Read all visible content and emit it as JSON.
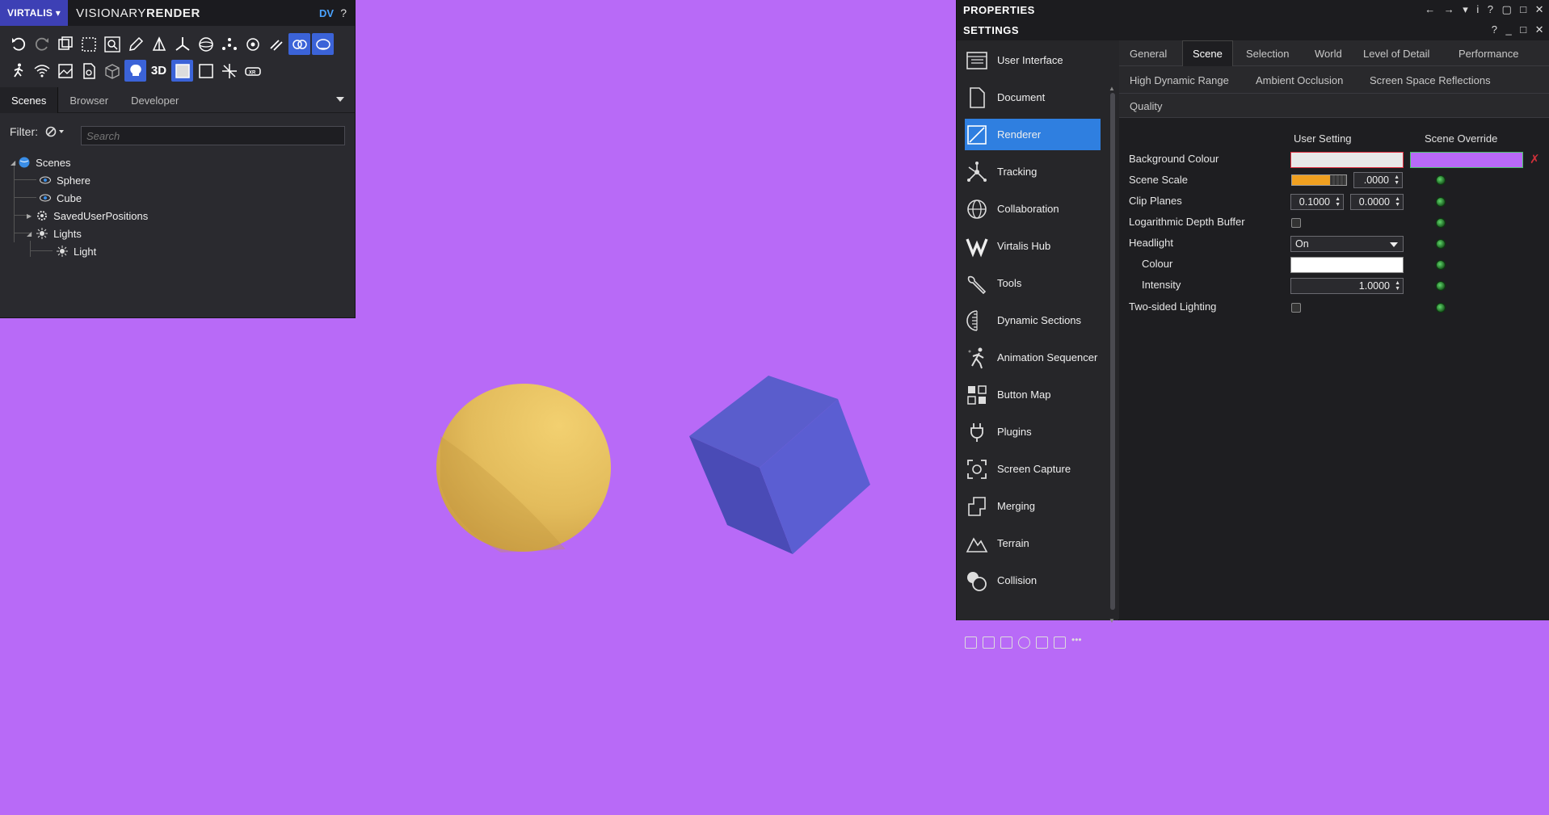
{
  "colors": {
    "viewport_bg": "#b86af7",
    "brand": "#3d40b5",
    "accent": "#2f7fe0",
    "sphere": "#e8c060",
    "cube": "#5a5cd0",
    "override_swatch": "#b86af7",
    "user_bg_swatch": "#e8e8e8"
  },
  "left_panel": {
    "brand": "VIRTALIS ▾",
    "app_name_light": "VISIONARY",
    "app_name_bold": "RENDER",
    "dv": "DV",
    "help": "?",
    "toolbar_row1": [
      "undo-icon",
      "redo-icon",
      "copy-icon",
      "select-box-icon",
      "zoom-icon",
      "edit-icon",
      "hierarchy-icon",
      "axis-icon",
      "sphere-icon",
      "nodes-icon",
      "rotate-icon",
      "link-icon",
      "collision-icon",
      "target-icon"
    ],
    "toolbar_row2": [
      "walk-icon",
      "wifi-icon",
      "image-icon",
      "document-icon",
      "box-icon",
      "light-icon",
      "3d-icon",
      "frame-icon",
      "square-icon",
      "move-icon",
      "vr-icon"
    ],
    "mode_3d": "3D",
    "tabs": [
      "Scenes",
      "Browser",
      "Developer"
    ],
    "filter_label": "Filter:",
    "search_placeholder": "Search",
    "tree": {
      "root": "Scenes",
      "sphere": "Sphere",
      "cube": "Cube",
      "saved": "SavedUserPositions",
      "lights": "Lights",
      "light": "Light"
    }
  },
  "right_panel": {
    "title": "PROPERTIES",
    "subtitle": "SETTINGS",
    "header_ctrls": [
      "←",
      "→",
      "▾",
      "i",
      "?",
      "▢",
      "□",
      "✕"
    ],
    "sub_ctrls": [
      "?",
      "_",
      "□",
      "✕"
    ],
    "sidebar": [
      {
        "label": "User Interface",
        "icon": "user-interface-icon"
      },
      {
        "label": "Document",
        "icon": "document-icon"
      },
      {
        "label": "Renderer",
        "icon": "renderer-icon"
      },
      {
        "label": "Tracking",
        "icon": "tracking-icon"
      },
      {
        "label": "Collaboration",
        "icon": "globe-icon"
      },
      {
        "label": "Virtalis Hub",
        "icon": "virtalis-hub-icon"
      },
      {
        "label": "Tools",
        "icon": "wrench-icon"
      },
      {
        "label": "Dynamic Sections",
        "icon": "dynamic-sections-icon"
      },
      {
        "label": "Animation Sequencer",
        "icon": "animation-icon"
      },
      {
        "label": "Button Map",
        "icon": "button-map-icon"
      },
      {
        "label": "Plugins",
        "icon": "plug-icon"
      },
      {
        "label": "Screen Capture",
        "icon": "screen-capture-icon"
      },
      {
        "label": "Merging",
        "icon": "merge-icon"
      },
      {
        "label": "Terrain",
        "icon": "terrain-icon"
      },
      {
        "label": "Collision",
        "icon": "collision-icon"
      }
    ],
    "tabs1": [
      "General",
      "Scene",
      "Selection",
      "World",
      "Level of Detail",
      "Performance"
    ],
    "tabs2": [
      "High Dynamic Range",
      "Ambient Occlusion",
      "Screen Space Reflections"
    ],
    "tabs3": [
      "Quality"
    ],
    "col_user": "User Setting",
    "col_override": "Scene Override",
    "props": {
      "bg_colour": "Background Colour",
      "scene_scale": "Scene Scale",
      "scene_scale_val": ".0000",
      "scene_scale_slider": 0.7,
      "clip_planes": "Clip Planes",
      "clip_near": "0.1000",
      "clip_far": "0.0000",
      "log_depth": "Logarithmic Depth Buffer",
      "headlight": "Headlight",
      "headlight_val": "On",
      "colour": "Colour",
      "intensity": "Intensity",
      "intensity_val": "1.0000",
      "two_sided": "Two-sided Lighting"
    }
  }
}
